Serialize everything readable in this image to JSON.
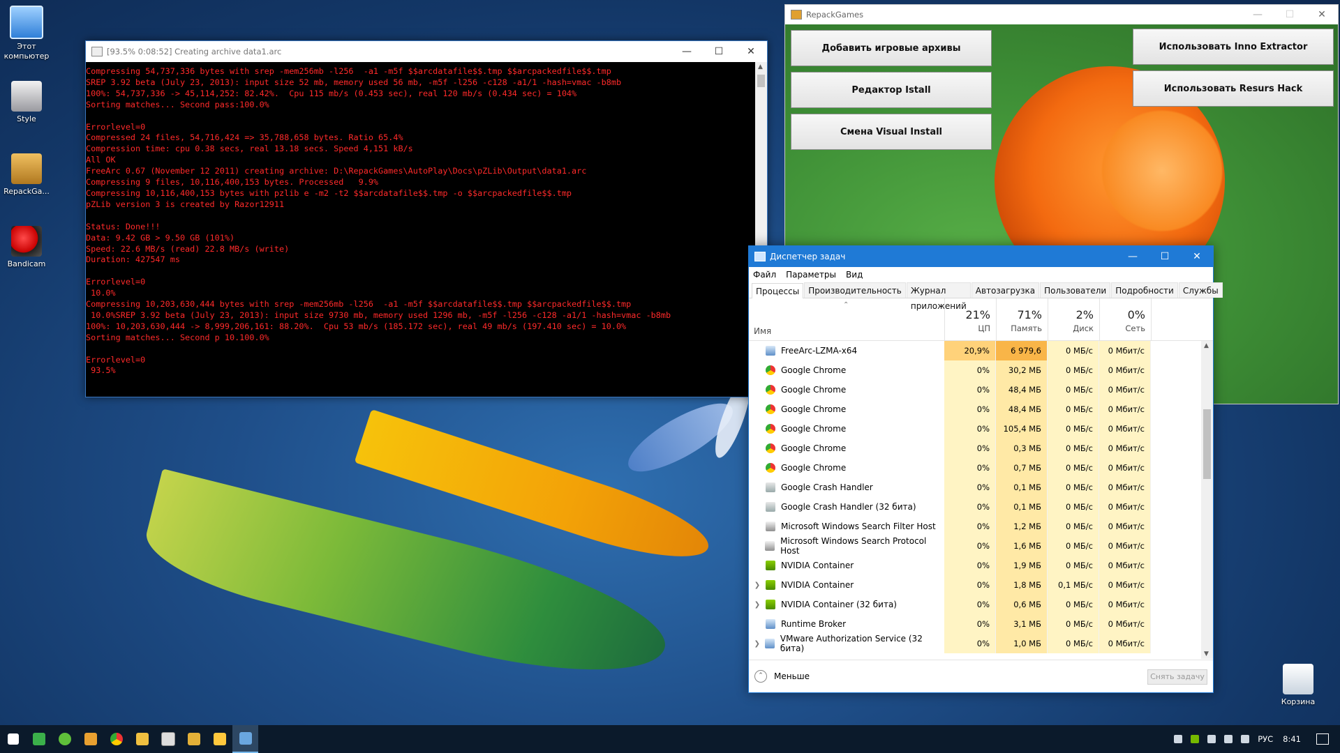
{
  "desktop": {
    "icons": [
      {
        "label": "Этот компьютер",
        "icon": "computer-icon"
      },
      {
        "label": "Style",
        "icon": "style-file-icon"
      },
      {
        "label": "RepackGa...",
        "icon": "folder-archive-icon"
      },
      {
        "label": "Bandicam",
        "icon": "bandicam-icon"
      },
      {
        "label": "Корзина",
        "icon": "recycle-bin-icon"
      }
    ]
  },
  "console": {
    "title": "[93.5% 0:08:52] Creating archive data1.arc",
    "lines": [
      "Compressing 54,737,336 bytes with srep -mem256mb -l256  -a1 -m5f $$arcdatafile$$.tmp $$arcpackedfile$$.tmp",
      "SREP 3.92 beta (July 23, 2013): input size 52 mb, memory used 56 mb, -m5f -l256 -c128 -a1/1 -hash=vmac -b8mb",
      "100%: 54,737,336 -> 45,114,252: 82.42%.  Cpu 115 mb/s (0.453 sec), real 120 mb/s (0.434 sec) = 104%",
      "Sorting matches... Second pass:100.0%",
      "",
      "Errorlevel=0",
      "Compressed 24 files, 54,716,424 => 35,788,658 bytes. Ratio 65.4%",
      "Compression time: cpu 0.38 secs, real 13.18 secs. Speed 4,151 kB/s",
      "All OK",
      "FreeArc 0.67 (November 12 2011) creating archive: D:\\RepackGames\\AutoPlay\\Docs\\pZLib\\Output\\data1.arc",
      "Compressing 9 files, 10,116,400,153 bytes. Processed   9.9%",
      "Compressing 10,116,400,153 bytes with pzlib e -m2 -t2 $$arcdatafile$$.tmp -o $$arcpackedfile$$.tmp",
      "pZLib version 3 is created by Razor12911",
      "",
      "Status: Done!!!",
      "Data: 9.42 GB > 9.50 GB (101%)",
      "Speed: 22.6 MB/s (read) 22.8 MB/s (write)",
      "Duration: 427547 ms",
      "",
      "Errorlevel=0",
      " 10.0%",
      "Compressing 10,203,630,444 bytes with srep -mem256mb -l256  -a1 -m5f $$arcdatafile$$.tmp $$arcpackedfile$$.tmp",
      " 10.0%SREP 3.92 beta (July 23, 2013): input size 9730 mb, memory used 1296 mb, -m5f -l256 -c128 -a1/1 -hash=vmac -b8mb",
      "100%: 10,203,630,444 -> 8,999,206,161: 88.20%.  Cpu 53 mb/s (185.172 sec), real 49 mb/s (197.410 sec) = 10.0%",
      "Sorting matches... Second p 10.100.0%",
      "",
      "Errorlevel=0",
      " 93.5%"
    ]
  },
  "repack": {
    "title": "RepackGames",
    "buttons": {
      "add_archives": "Добавить игровые архивы",
      "editor_install": "Редактор Istall",
      "change_visual": "Смена Visual Install",
      "inno_extractor": "Использовать Inno Extractor",
      "resurs_hack": "Использовать Resurs Hack"
    }
  },
  "taskmgr": {
    "title": "Диспетчер задач",
    "menu": [
      "Файл",
      "Параметры",
      "Вид"
    ],
    "tabs": [
      "Процессы",
      "Производительность",
      "Журнал приложений",
      "Автозагрузка",
      "Пользователи",
      "Подробности",
      "Службы"
    ],
    "columns": {
      "name": "Имя",
      "cpu": {
        "pct": "21%",
        "label": "ЦП"
      },
      "mem": {
        "pct": "71%",
        "label": "Память"
      },
      "disk": {
        "pct": "2%",
        "label": "Диск"
      },
      "net": {
        "pct": "0%",
        "label": "Сеть"
      }
    },
    "rows": [
      {
        "name": "FreeArc-LZMA-x64",
        "icon": "app-window-icon",
        "cpu": "20,9%",
        "mem": "6 979,6 МБ",
        "disk": "0 МБ/с",
        "net": "0 Мбит/с",
        "expand": false,
        "hot": true
      },
      {
        "name": "Google Chrome",
        "icon": "chrome-icon",
        "cpu": "0%",
        "mem": "30,2 МБ",
        "disk": "0 МБ/с",
        "net": "0 Мбит/с",
        "expand": false
      },
      {
        "name": "Google Chrome",
        "icon": "chrome-icon",
        "cpu": "0%",
        "mem": "48,4 МБ",
        "disk": "0 МБ/с",
        "net": "0 Мбит/с",
        "expand": false
      },
      {
        "name": "Google Chrome",
        "icon": "chrome-icon",
        "cpu": "0%",
        "mem": "48,4 МБ",
        "disk": "0 МБ/с",
        "net": "0 Мбит/с",
        "expand": false
      },
      {
        "name": "Google Chrome",
        "icon": "chrome-icon",
        "cpu": "0%",
        "mem": "105,4 МБ",
        "disk": "0 МБ/с",
        "net": "0 Мбит/с",
        "expand": false
      },
      {
        "name": "Google Chrome",
        "icon": "chrome-icon",
        "cpu": "0%",
        "mem": "0,3 МБ",
        "disk": "0 МБ/с",
        "net": "0 Мбит/с",
        "expand": false
      },
      {
        "name": "Google Chrome",
        "icon": "chrome-icon",
        "cpu": "0%",
        "mem": "0,7 МБ",
        "disk": "0 МБ/с",
        "net": "0 Мбит/с",
        "expand": false
      },
      {
        "name": "Google Crash Handler",
        "icon": "crash-handler-icon",
        "cpu": "0%",
        "mem": "0,1 МБ",
        "disk": "0 МБ/с",
        "net": "0 Мбит/с",
        "expand": false
      },
      {
        "name": "Google Crash Handler (32 бита)",
        "icon": "crash-handler-icon",
        "cpu": "0%",
        "mem": "0,1 МБ",
        "disk": "0 МБ/с",
        "net": "0 Мбит/с",
        "expand": false
      },
      {
        "name": "Microsoft Windows Search Filter Host",
        "icon": "search-host-icon",
        "cpu": "0%",
        "mem": "1,2 МБ",
        "disk": "0 МБ/с",
        "net": "0 Мбит/с",
        "expand": false
      },
      {
        "name": "Microsoft Windows Search Protocol Host",
        "icon": "search-host-icon",
        "cpu": "0%",
        "mem": "1,6 МБ",
        "disk": "0 МБ/с",
        "net": "0 Мбит/с",
        "expand": false
      },
      {
        "name": "NVIDIA Container",
        "icon": "nvidia-icon",
        "cpu": "0%",
        "mem": "1,9 МБ",
        "disk": "0 МБ/с",
        "net": "0 Мбит/с",
        "expand": false
      },
      {
        "name": "NVIDIA Container",
        "icon": "nvidia-icon",
        "cpu": "0%",
        "mem": "1,8 МБ",
        "disk": "0,1 МБ/с",
        "net": "0 Мбит/с",
        "expand": true
      },
      {
        "name": "NVIDIA Container (32 бита)",
        "icon": "nvidia-icon",
        "cpu": "0%",
        "mem": "0,6 МБ",
        "disk": "0 МБ/с",
        "net": "0 Мбит/с",
        "expand": true
      },
      {
        "name": "Runtime Broker",
        "icon": "app-window-icon",
        "cpu": "0%",
        "mem": "3,1 МБ",
        "disk": "0 МБ/с",
        "net": "0 Мбит/с",
        "expand": false
      },
      {
        "name": "VMware Authorization Service (32 бита)",
        "icon": "app-window-icon",
        "cpu": "0%",
        "mem": "1,0 МБ",
        "disk": "0 МБ/с",
        "net": "0 Мбит/с",
        "expand": true
      }
    ],
    "less_label": "Меньше",
    "end_task_label": "Снять задачу"
  },
  "taskbar": {
    "lang": "РУС",
    "time": "8:41"
  }
}
